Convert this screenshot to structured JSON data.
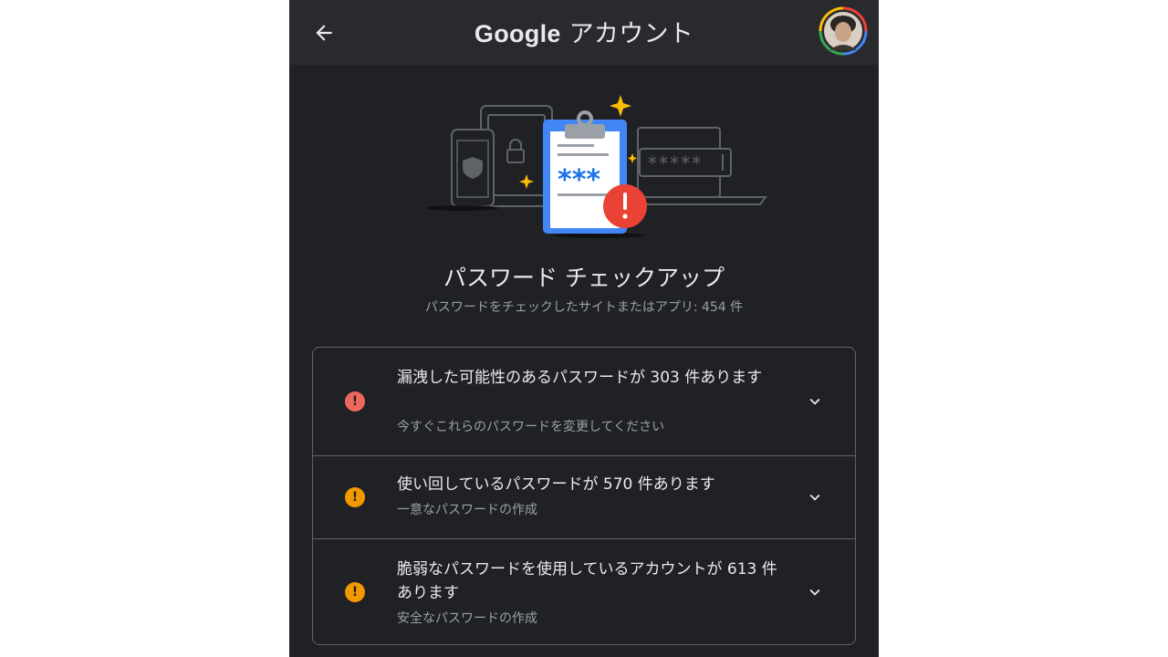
{
  "header": {
    "brand": "Google",
    "title_suffix": "アカウント",
    "back_icon": "arrow-left-icon",
    "avatar_icon": "user-avatar"
  },
  "checkup": {
    "title": "パスワード チェックアップ",
    "subtitle": "パスワードをチェックしたサイトまたはアプリ: 454 件",
    "illustration_masked_text": "***"
  },
  "issues": [
    {
      "title": "漏洩した可能性のあるパスワードが 303 件あります",
      "subtitle": "今すぐこれらのパスワードを変更してください",
      "severity_color": "#ee675c",
      "icon": "alert-icon"
    },
    {
      "title": "使い回しているパスワードが 570 件あります",
      "subtitle": "一意なパスワードの作成",
      "severity_color": "#f29900",
      "icon": "alert-icon"
    },
    {
      "title": "脆弱なパスワードを使用しているアカウントが 613 件あります",
      "subtitle": "安全なパスワードの作成",
      "severity_color": "#f29900",
      "icon": "alert-icon"
    }
  ],
  "colors": {
    "background": "#202124",
    "topbar": "#292a2d",
    "text_primary": "#e8eaed",
    "text_secondary": "#9aa0a6",
    "clipboard_blue": "#4285f4"
  }
}
